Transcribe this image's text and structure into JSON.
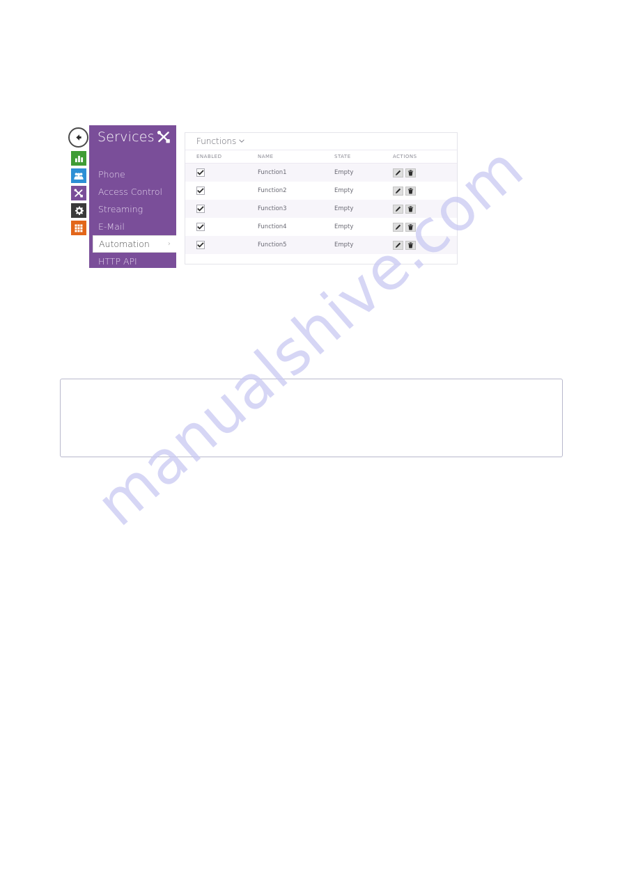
{
  "app": {
    "back_button_label": "Back",
    "panel_title": "Services",
    "panel_title_icon": "tools-icon"
  },
  "icon_rail": [
    {
      "name": "status-icon",
      "label": "Status",
      "color": "#3f9c35"
    },
    {
      "name": "directory-icon",
      "label": "Directory",
      "color": "#2d8fd5"
    },
    {
      "name": "services-icon",
      "label": "Services",
      "color": "#7a4e99"
    },
    {
      "name": "system-icon",
      "label": "System",
      "color": "#3a3a3a"
    },
    {
      "name": "apps-grid-icon",
      "label": "Applications",
      "color": "#e2661a"
    }
  ],
  "menu": {
    "items": [
      {
        "label": "Phone",
        "selected": false,
        "chevron": ""
      },
      {
        "label": "Access Control",
        "selected": false,
        "chevron": ""
      },
      {
        "label": "Streaming",
        "selected": false,
        "chevron": ""
      },
      {
        "label": "E-Mail",
        "selected": false,
        "chevron": ""
      },
      {
        "label": "Automation",
        "selected": true,
        "chevron": "›"
      },
      {
        "label": "HTTP API",
        "selected": false,
        "chevron": ""
      }
    ]
  },
  "content": {
    "tab_label": "Functions",
    "tab_caret": "⌄",
    "columns": [
      "ENABLED",
      "NAME",
      "STATE",
      "ACTIONS"
    ],
    "rows": [
      {
        "enabled": true,
        "name": "Function1",
        "state": "Empty",
        "edit": "edit-icon",
        "delete": "trash-icon"
      },
      {
        "enabled": true,
        "name": "Function2",
        "state": "Empty",
        "edit": "edit-icon",
        "delete": "trash-icon"
      },
      {
        "enabled": true,
        "name": "Function3",
        "state": "Empty",
        "edit": "edit-icon",
        "delete": "trash-icon"
      },
      {
        "enabled": true,
        "name": "Function4",
        "state": "Empty",
        "edit": "edit-icon",
        "delete": "trash-icon"
      },
      {
        "enabled": true,
        "name": "Function5",
        "state": "Empty",
        "edit": "edit-icon",
        "delete": "trash-icon"
      }
    ]
  },
  "note_box": {
    "text": ""
  },
  "watermark": {
    "text": "manualshive.com",
    "color": "#c9c9f2"
  },
  "colors": {
    "brand_purple": "#7a4e99",
    "row_stripe": "#f7f5fa",
    "panel_border": "#e4e4ea"
  }
}
